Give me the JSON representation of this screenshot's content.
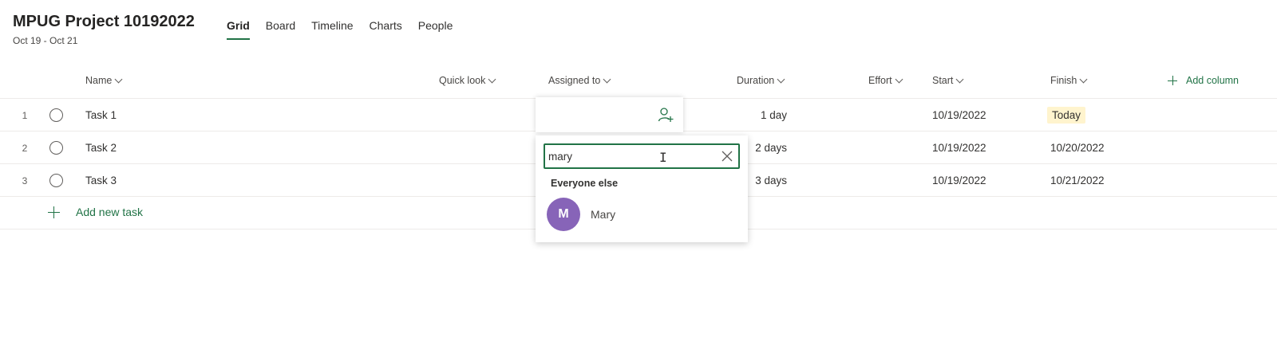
{
  "header": {
    "title": "MPUG Project 10192022",
    "dates": "Oct 19 - Oct 21"
  },
  "tabs": [
    {
      "label": "Grid",
      "active": true
    },
    {
      "label": "Board",
      "active": false
    },
    {
      "label": "Timeline",
      "active": false
    },
    {
      "label": "Charts",
      "active": false
    },
    {
      "label": "People",
      "active": false
    }
  ],
  "columns": {
    "name": "Name",
    "quick_look": "Quick look",
    "assigned_to": "Assigned to",
    "duration": "Duration",
    "effort": "Effort",
    "start": "Start",
    "finish": "Finish",
    "add_column": "Add column"
  },
  "tasks": [
    {
      "num": "1",
      "name": "Task 1",
      "duration": "1 day",
      "start": "10/19/2022",
      "finish": "Today"
    },
    {
      "num": "2",
      "name": "Task 2",
      "duration": "2 days",
      "start": "10/19/2022",
      "finish": "10/20/2022"
    },
    {
      "num": "3",
      "name": "Task 3",
      "duration": "3 days",
      "start": "10/19/2022",
      "finish": "10/21/2022"
    }
  ],
  "add_task_label": "Add new task",
  "assign_picker": {
    "search_value": "mary",
    "section_label": "Everyone else",
    "people": [
      {
        "initial": "M",
        "name": "Mary",
        "avatar_color": "#8764b8"
      }
    ]
  },
  "colors": {
    "accent": "#217346",
    "today_badge": "#fff4ce"
  }
}
